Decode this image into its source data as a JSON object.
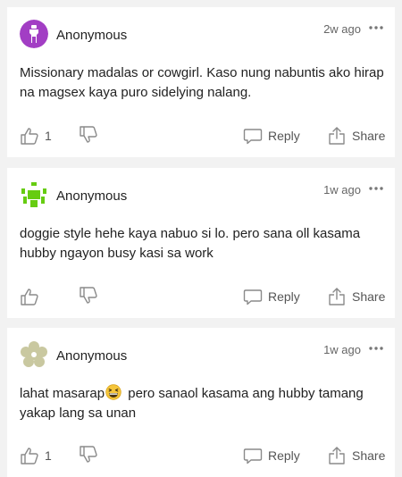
{
  "comments": [
    {
      "author": "Anonymous",
      "time": "2w ago",
      "text": "Missionary madalas or cowgirl. Kaso nung nabuntis ako hirap na magsex kaya puro sidelying nalang.",
      "like_count": "1",
      "avatar_icon": "purple-vase-avatar",
      "avatar_color": "#a23ec4"
    },
    {
      "author": "Anonymous",
      "time": "1w ago",
      "text": "doggie style hehe kaya nabuo si lo. pero sana oll kasama hubby ngayon busy kasi sa work",
      "like_count": "",
      "avatar_icon": "green-invader-avatar",
      "avatar_color": "#66cc11"
    },
    {
      "author": "Anonymous",
      "time": "1w ago",
      "text_before_emoji": "lahat masarap",
      "text_after_emoji": " pero sanaol kasama ang hubby tamang yakap lang sa unan",
      "emoji_icon": "grinning-squinting-face-emoji",
      "like_count": "1",
      "avatar_icon": "olive-flower-avatar",
      "avatar_color": "#c9c8a0"
    }
  ],
  "labels": {
    "reply": "Reply",
    "share": "Share"
  },
  "colors": {
    "background": "#f2f2f2",
    "card": "#ffffff",
    "icon": "#8a8a8a"
  }
}
